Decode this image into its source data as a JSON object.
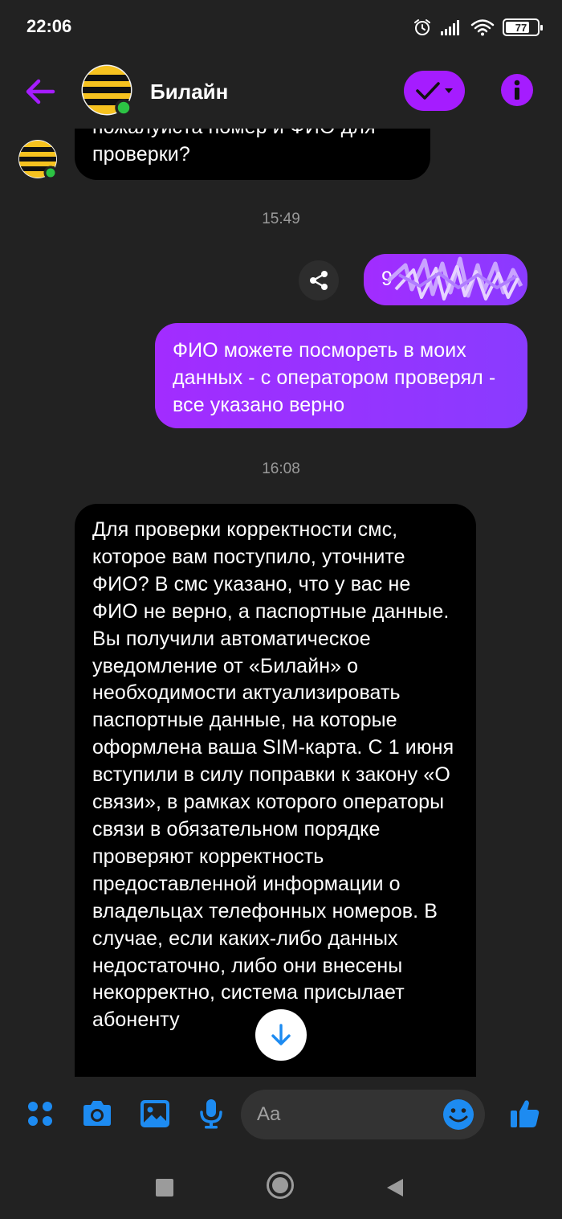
{
  "status_bar": {
    "time": "22:06",
    "battery": "77"
  },
  "header": {
    "contact_name": "Билайн"
  },
  "colors": {
    "accent": "#a51cff",
    "messenger_blue": "#1d8bf1",
    "online": "#2cc344"
  },
  "messages": [
    {
      "from": "contact",
      "text": "пожалуйста номер и ФИО для проверки?"
    },
    {
      "type": "timestamp",
      "text": "15:49"
    },
    {
      "from": "me",
      "text": "9",
      "redacted": true
    },
    {
      "from": "me",
      "text": "ФИО можете посмореть в моих данных - с оператором проверял - все указано верно"
    },
    {
      "type": "timestamp",
      "text": "16:08"
    },
    {
      "from": "contact",
      "text": "Для проверки корректности смс, которое вам поступило, уточните ФИО? В смс указано, что у вас не ФИО не верно, а паспортные данные. Вы получили автоматическое уведомление от «Билайн» о необходимости актуализировать паспортные данные, на которые оформлена ваша SIM-карта. С 1 июня вступили в силу поправки к закону «О связи», в рамках которого операторы связи в обязательном порядке проверяют корректность предоставленной информации о владельцах телефонных номеров. В случае, если каких-либо данных недостаточно, либо они внесены некорректно, система присылает абоненту"
    }
  ],
  "composer": {
    "placeholder": "Aa"
  },
  "icons": {
    "back": "arrow-left-icon",
    "check_menu": "check-icon",
    "info": "info-icon",
    "share": "share-icon",
    "scroll_down": "arrow-down-icon",
    "menu": "dots-grid-icon",
    "camera": "camera-icon",
    "gallery": "image-icon",
    "mic": "microphone-icon",
    "emoji": "smiley-icon",
    "like": "thumbs-up-icon"
  }
}
